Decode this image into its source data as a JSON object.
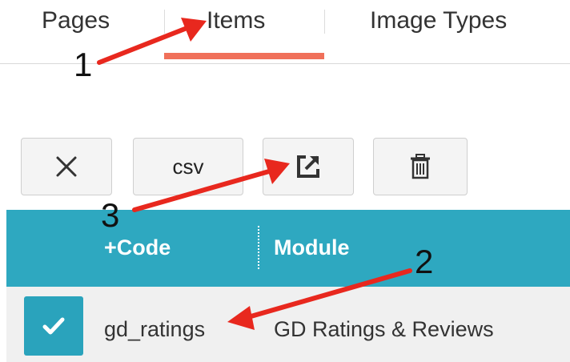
{
  "tabs": [
    {
      "label": "Pages"
    },
    {
      "label": "Items"
    },
    {
      "label": "Image Types"
    }
  ],
  "toolbar": {
    "csv_label": "csv",
    "close_icon": "close-icon",
    "export_icon": "export-icon",
    "delete_icon": "trash-icon"
  },
  "table": {
    "columns": [
      "+Code",
      "Module"
    ],
    "rows": [
      {
        "checked": true,
        "code": "gd_ratings",
        "module": "GD Ratings & Reviews"
      }
    ]
  },
  "annotations": [
    "1",
    "2",
    "3"
  ],
  "colors": {
    "accent": "#2ea8c0",
    "tab_underline": "#f0705a",
    "arrow": "#e8281e"
  }
}
